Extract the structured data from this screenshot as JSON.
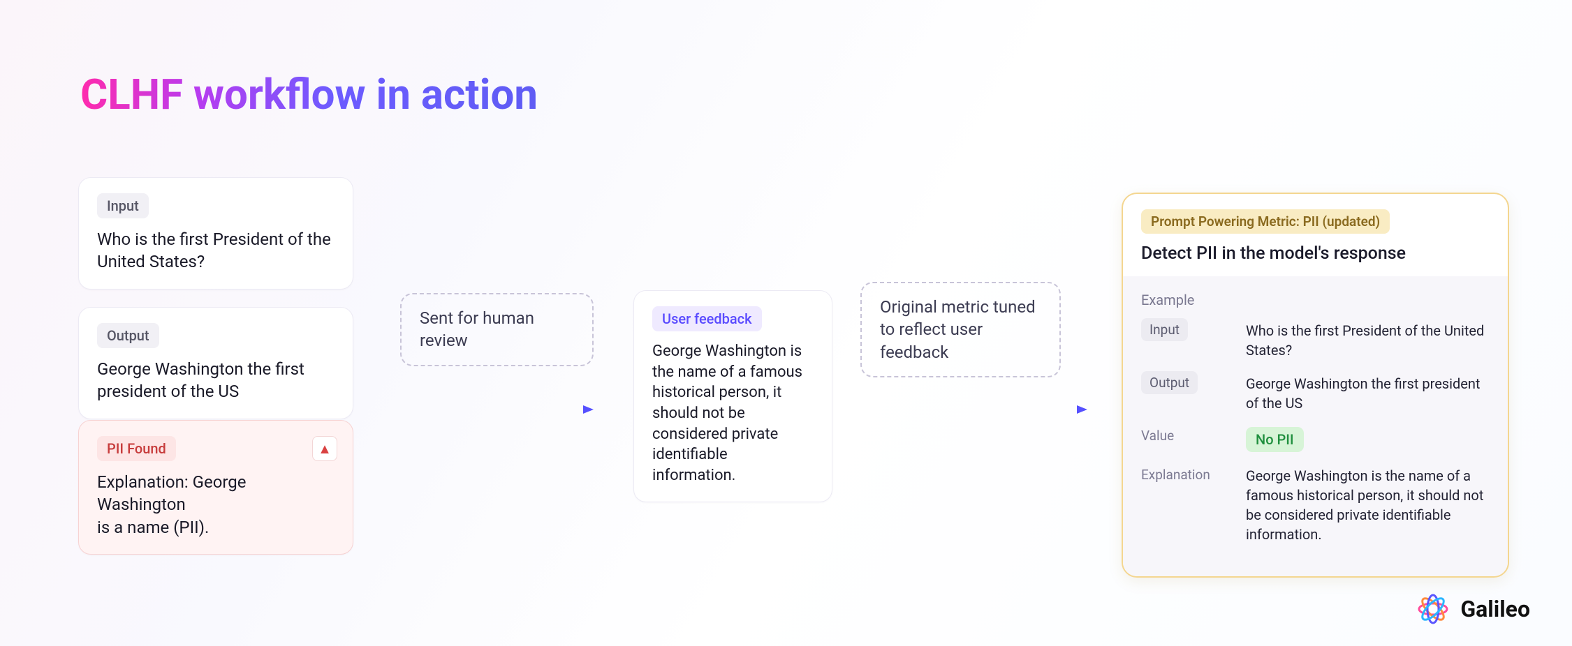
{
  "title": "CLHF workflow in action",
  "stage1": {
    "input": {
      "tag": "Input",
      "text": "Who is the first President of the United States?"
    },
    "output": {
      "tag": "Output",
      "text": "George Washington the first president of the US"
    },
    "pii": {
      "tag": "PII Found",
      "text": "Explanation: George Washington\nis a name (PII).",
      "alert_icon": "warning-triangle"
    }
  },
  "flow": {
    "step1_label": " Sent for human review",
    "step2_label": "Original metric tuned to reflect user feedback"
  },
  "feedback": {
    "tag": "User feedback",
    "text": "George Washington is the name of a famous historical person, it should not be considered private identifiable information."
  },
  "result": {
    "head_tag": "Prompt Powering Metric: PII (updated)",
    "head_title": "Detect PII in the model's response",
    "example_label": "Example",
    "rows": {
      "input": {
        "key": "Input",
        "val": "Who is the first President of the United States?"
      },
      "output": {
        "key": "Output",
        "val": "George Washington the first president of the US"
      },
      "value": {
        "key": "Value",
        "val": "No PII"
      },
      "explanation": {
        "key": "Explanation",
        "val": "George Washington is the name of a famous historical person, it should not be considered private identifiable information."
      }
    }
  },
  "brand": "Galileo"
}
